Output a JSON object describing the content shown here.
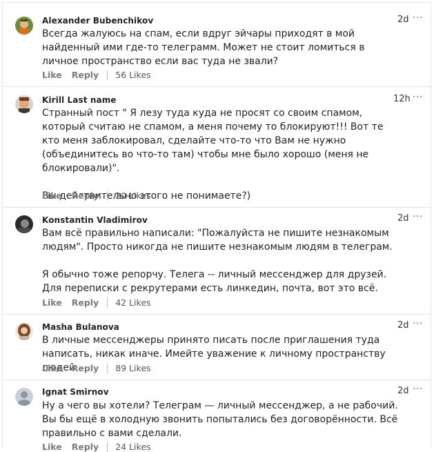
{
  "comments": [
    {
      "author": "Alexander Bubenchikov",
      "time": "2d",
      "text": "Всегда жалуюсь на спам, если вдруг эйчары приходят в мой найденный ими где-то телеграмм. Может не стоит ломиться в личное пространство если вас туда не звали?",
      "like_label": "Like",
      "reply_label": "Reply",
      "likes": "56 Likes",
      "avatar_icon": "user-photo-icon"
    },
    {
      "author": "Kirill Last name",
      "time": "12h",
      "text": "Странный пост \" Я лезу туда куда не просят со своим спамом, который считаю не спамом, а меня почему то блокируют!!! Вот те кто меня заблокировал, сделайте что-то что Вам не нужно (объединитесь во что-то там) чтобы мне было хорошо (меня не блокировали)\".\n\nВы действительно этого не понимаете?)",
      "like_label": "Like",
      "reply_label": "Reply",
      "likes": "20 Likes",
      "avatar_icon": "user-photo-icon"
    },
    {
      "author": "Konstantin Vladimirov",
      "time": "2d",
      "text": "Вам всё правильно написали: \"Пожалуйста не пишите незнакомым людям\". Просто никогда не пишите незнакомым людям в телеграм.\n\nЯ обычно тоже репорчу. Телега -- личный мессенджер для друзей. Для переписки с рекрутерами есть линкедин, почта, вот это всё.",
      "like_label": "Like",
      "reply_label": "Reply",
      "likes": "42 Likes",
      "avatar_icon": "user-photo-icon"
    },
    {
      "author": "Masha Bulanova",
      "time": "2d",
      "text": "В личные мессенджеры принято писать после приглашения туда написать, никак иначе. Имейте уважение к личному пространству людей.",
      "like_label": "Like",
      "reply_label": "Reply",
      "likes": "89 Likes",
      "avatar_icon": "user-photo-icon"
    },
    {
      "author": "Ignat Smirnov",
      "time": "2d",
      "text": "Ну а чего вы хотели? Телеграм — личный мессенджер, а не рабочий. Вы бы ещё в холодную звонить попытались без договорённости. Всё правильно с вами сделали.",
      "like_label": "Like",
      "reply_label": "Reply",
      "likes": "24 Likes",
      "avatar_icon": "default-avatar-icon"
    }
  ],
  "more_label": "···"
}
